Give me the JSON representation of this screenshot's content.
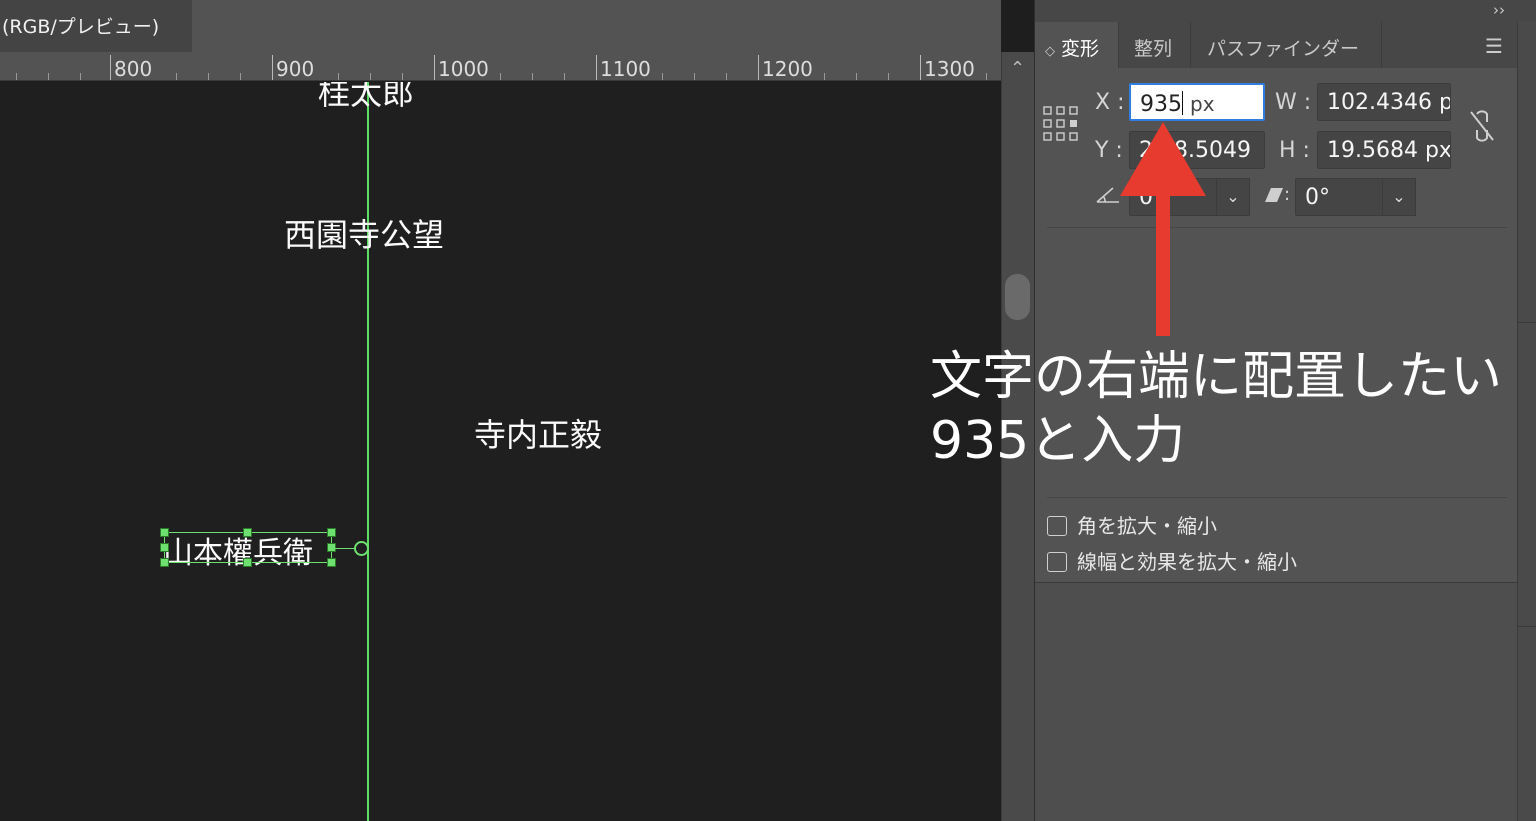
{
  "document": {
    "tab_title": "(RGB/プレビュー)"
  },
  "ruler": {
    "labels": [
      "800",
      "900",
      "1000",
      "1100",
      "1200",
      "1300"
    ]
  },
  "canvas": {
    "names": [
      "桂太郎",
      "西園寺公望",
      "寺内正毅",
      "山本權兵衛"
    ]
  },
  "panel": {
    "tabs": [
      {
        "label": "変形",
        "active": true
      },
      {
        "label": "整列",
        "active": false
      },
      {
        "label": "パスファインダー",
        "active": false
      }
    ],
    "transform": {
      "x_label": "X :",
      "x_value": "935",
      "x_unit": "px",
      "y_label": "Y :",
      "y_value": "2 58.5049",
      "w_label": "W :",
      "w_value": "102.4346 p",
      "h_label": "H :",
      "h_value": "19.5684 px",
      "rotate_value": "0",
      "shear_value": "0°"
    },
    "options": {
      "scale_corners": "角を拡大・縮小",
      "scale_strokes": "線幅と効果を拡大・縮小"
    }
  },
  "annotation": {
    "line1": "文字の右端に配置したい",
    "line2": "935と入力",
    "arrow_color": "#e63b2e"
  },
  "colors": {
    "guide": "#5ce063",
    "focus": "#2f7de1",
    "panel": "#535353",
    "canvas": "#1f1f1f"
  }
}
